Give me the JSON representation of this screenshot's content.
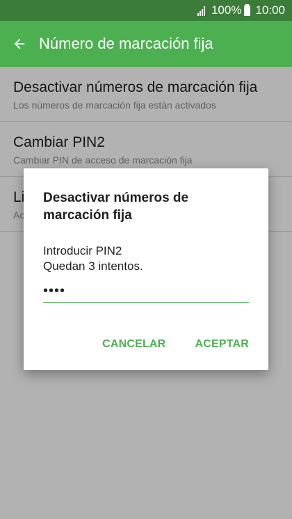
{
  "status_bar": {
    "battery": "100%",
    "time": "10:00",
    "icons": [
      "signal-icon",
      "battery-icon"
    ]
  },
  "app_bar": {
    "back_icon": "back-arrow-icon",
    "title": "Número de marcación fija"
  },
  "list": {
    "items": [
      {
        "title": "Desactivar números de marcación fija",
        "subtitle": "Los números de marcación fija están activados"
      },
      {
        "title": "Cambiar PIN2",
        "subtitle": "Cambiar PIN de acceso de marcación fija"
      },
      {
        "title": "Li",
        "subtitle": "Ac"
      }
    ]
  },
  "dialog": {
    "title": "Desactivar números de marcación fija",
    "prompt": "Introducir PIN2",
    "attempts": "Quedan 3 intentos.",
    "pin_value": "••••",
    "cancel_label": "CANCELAR",
    "accept_label": "ACEPTAR"
  },
  "colors": {
    "status_bar": "#3b7d38",
    "app_bar": "#4caf50",
    "accent": "#4caf50"
  }
}
